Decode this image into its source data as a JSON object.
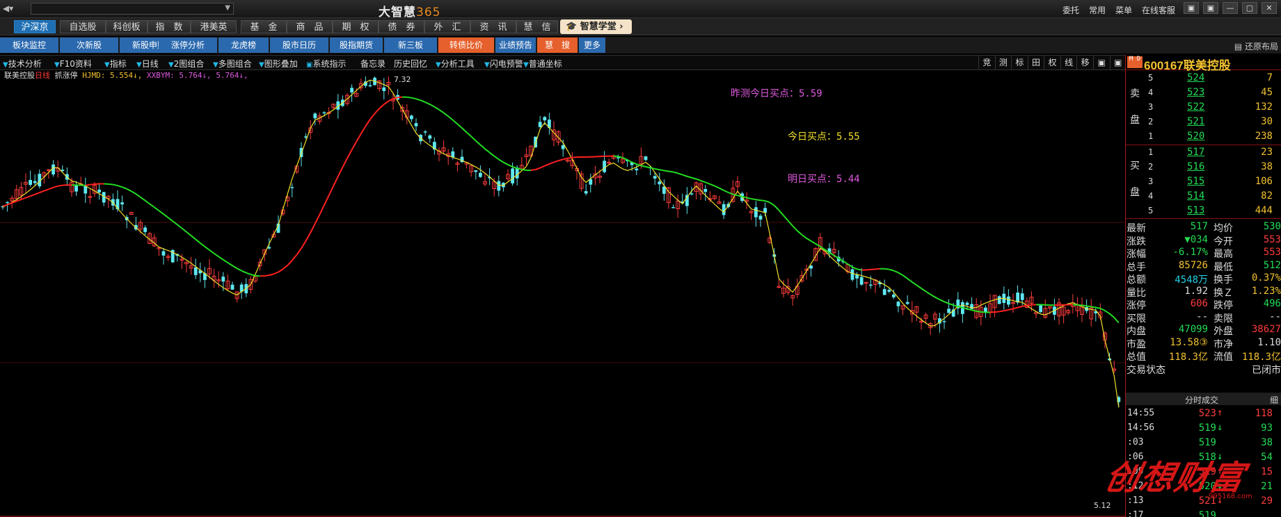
{
  "titlebar": {
    "app_name": "大智慧",
    "app_number": "365",
    "links": [
      "委托",
      "常用",
      "菜单",
      "在线客服"
    ],
    "window_buttons": [
      "▣",
      "▣",
      "—",
      "▢",
      "✕"
    ]
  },
  "menu": {
    "items": [
      "沪深京",
      "自选股",
      "科创板",
      "指　数",
      "港美英",
      "基　金",
      "商　品",
      "期　权",
      "债　券",
      "外　汇",
      "资　讯",
      "慧　信"
    ],
    "academy": "智慧学堂"
  },
  "functions": {
    "items": [
      "板块监控",
      "次新股",
      "新股申购",
      "涨停分析",
      "龙虎榜",
      "股市日历",
      "股指期货",
      "新三板",
      "转债比价",
      "业绩预告",
      "慧　搜",
      "更多"
    ],
    "restore": "还原布局"
  },
  "toolbar": {
    "items": [
      "技术分析",
      "F10资料",
      "指标",
      "日线",
      "2图组合",
      "多图组合",
      "图形叠加",
      "系统指示",
      "备忘录",
      "历史回忆",
      "分析工具",
      "闪电预警",
      "普通坐标"
    ],
    "right_tools": [
      "竞",
      "测",
      "标",
      "田",
      "权",
      "线",
      "移",
      "▣",
      "▣"
    ]
  },
  "indicator": {
    "stock": "联美控股",
    "period": "日线",
    "label": "抓涨停",
    "hjmd": "HJMD: 5.554↓,",
    "xxbym": "XXBYM: 5.764↓,",
    "val3": "5.764↓,"
  },
  "chart": {
    "high_label": "7.32",
    "low_label": "5.12",
    "predict_label": "昨测今日买点：5.59",
    "today_label": "今日买点：5.55",
    "tomorrow_label": "明日买点：5.44"
  },
  "quote": {
    "code": "600167",
    "name": "联美控股",
    "badge": "M D",
    "sell_label": [
      "卖",
      "盘"
    ],
    "buy_label": [
      "买",
      "盘"
    ],
    "asks": [
      {
        "level": "5",
        "price": "524",
        "vol": "7"
      },
      {
        "level": "4",
        "price": "523",
        "vol": "45"
      },
      {
        "level": "3",
        "price": "522",
        "vol": "132"
      },
      {
        "level": "2",
        "price": "521",
        "vol": "30"
      },
      {
        "level": "1",
        "price": "520",
        "vol": "238"
      }
    ],
    "bids": [
      {
        "level": "1",
        "price": "517",
        "vol": "23"
      },
      {
        "level": "2",
        "price": "516",
        "vol": "38"
      },
      {
        "level": "3",
        "price": "515",
        "vol": "106"
      },
      {
        "level": "4",
        "price": "514",
        "vol": "82"
      },
      {
        "level": "5",
        "price": "513",
        "vol": "444"
      }
    ],
    "rows": [
      {
        "l": "最新",
        "v": "517",
        "vc": "g",
        "l2": "均价",
        "v2": "530",
        "v2c": "g"
      },
      {
        "l": "涨跌",
        "v": "▼034",
        "vc": "g",
        "l2": "今开",
        "v2": "553",
        "v2c": "r"
      },
      {
        "l": "涨幅",
        "v": "-6.17%",
        "vc": "g",
        "l2": "最高",
        "v2": "553",
        "v2c": "r"
      },
      {
        "l": "总手",
        "v": "85726",
        "vc": "y",
        "l2": "最低",
        "v2": "512",
        "v2c": "g"
      },
      {
        "l": "总额",
        "v": "4548万",
        "vc": "c",
        "l2": "换手",
        "v2": "0.37%",
        "v2c": "y"
      },
      {
        "l": "量比",
        "v": "1.92",
        "vc": "w",
        "l2": "换Ｚ",
        "v2": "1.23%",
        "v2c": "y"
      },
      {
        "l": "涨停",
        "v": "606",
        "vc": "r",
        "l2": "跌停",
        "v2": "496",
        "v2c": "g"
      },
      {
        "l": "买限",
        "v": "--",
        "vc": "w",
        "l2": "卖限",
        "v2": "--",
        "v2c": "w"
      },
      {
        "l": "内盘",
        "v": "47099",
        "vc": "g",
        "l2": "外盘",
        "v2": "38627",
        "v2c": "r"
      },
      {
        "l": "市盈",
        "v": "13.58③",
        "vc": "y",
        "l2": "市净",
        "v2": "1.10",
        "v2c": "w"
      },
      {
        "l": "总值",
        "v": "118.3亿",
        "vc": "y",
        "l2": "流值",
        "v2": "118.3亿",
        "v2c": "y"
      },
      {
        "l": "交易状态",
        "v": "",
        "vc": "w",
        "l2": "",
        "v2": "已闭市",
        "v2c": "w"
      }
    ],
    "trades_title": "分时成交",
    "trades_tab": "细",
    "trades": [
      {
        "t": "14:55",
        "p": "523",
        "a": "↑",
        "q": "118",
        "pc": "r"
      },
      {
        "t": "14:56",
        "p": "519",
        "a": "↓",
        "q": "93",
        "pc": "g"
      },
      {
        "t": ":03",
        "p": "519",
        "a": "",
        "q": "38",
        "pc": "g"
      },
      {
        "t": ":06",
        "p": "518",
        "a": "↓",
        "q": "54",
        "pc": "g"
      },
      {
        "t": ":09",
        "p": "519",
        "a": "↑",
        "q": "15",
        "pc": "r"
      },
      {
        "t": ":12",
        "p": "520",
        "a": "↓",
        "q": "21",
        "pc": "g"
      },
      {
        "t": ":13",
        "p": "521",
        "a": "↓",
        "q": "29",
        "pc": "r"
      },
      {
        "t": ":17",
        "p": "519",
        "a": "",
        "q": "",
        "pc": "g"
      }
    ]
  },
  "watermark": {
    "text": "创想财富",
    "sub": "995168.com"
  },
  "colors": {
    "up": "#ff3c3c",
    "down": "#22dd55",
    "candle_down": "#5ee8f2",
    "ma_up": "#ff2020",
    "ma_down": "#22dd22",
    "fast": "#f2e02a"
  }
}
